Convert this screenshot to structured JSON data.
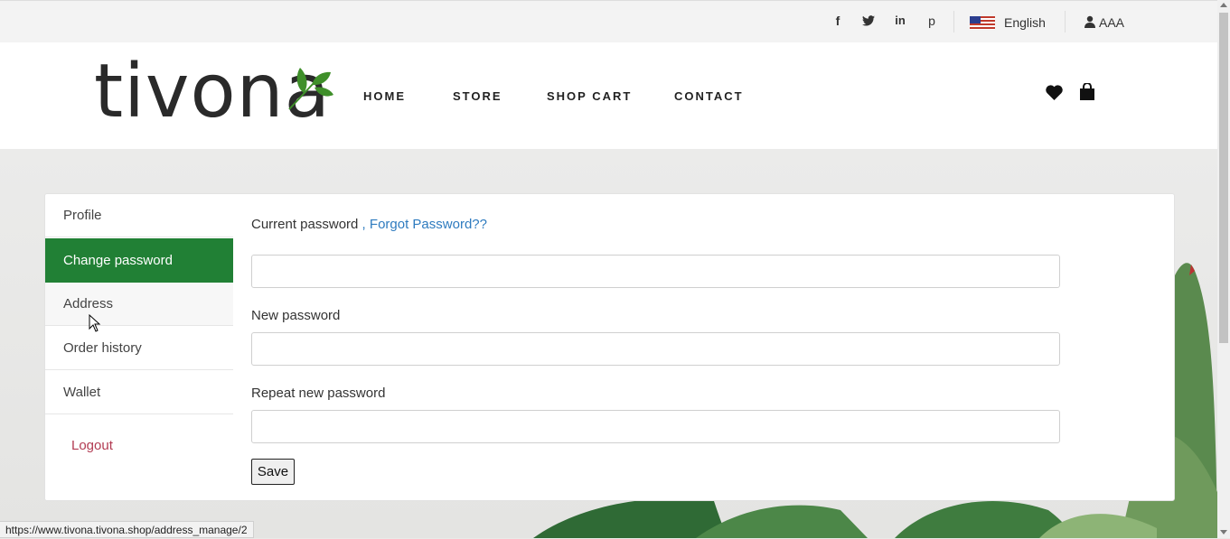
{
  "topbar": {
    "social": [
      "f",
      "t",
      "in",
      "p"
    ],
    "language": "English",
    "user": "AAA"
  },
  "header": {
    "logo": "tivona",
    "nav": [
      "HOME",
      "STORE",
      "SHOP CART",
      "CONTACT"
    ]
  },
  "sidebar": {
    "items": [
      {
        "label": "Profile"
      },
      {
        "label": "Change password",
        "active": true
      },
      {
        "label": "Address"
      },
      {
        "label": "Order history"
      },
      {
        "label": "Wallet"
      }
    ],
    "logout": "Logout"
  },
  "form": {
    "current_label": "Current password",
    "separator": " , ",
    "forgot_link": "Forgot Password??",
    "new_label": "New password",
    "repeat_label": "Repeat new password",
    "current_value": "",
    "new_value": "",
    "repeat_value": "",
    "save_label": "Save"
  },
  "status_url": "https://www.tivona.tivona.shop/address_manage/2",
  "colors": {
    "brand_green": "#218035",
    "link": "#2e7bbf",
    "logout": "#b23b52"
  }
}
